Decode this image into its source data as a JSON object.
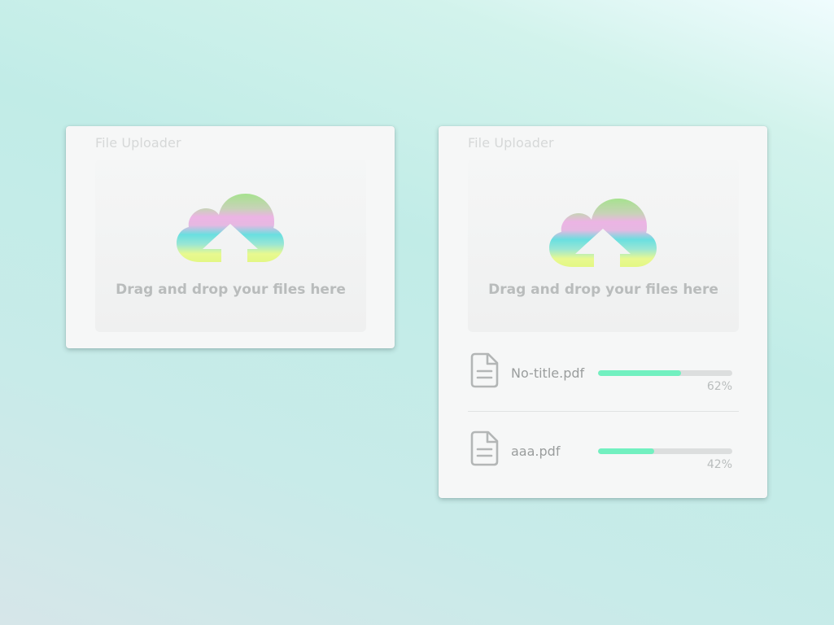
{
  "colors": {
    "card_background": "#f6f7f7",
    "dropzone_background": "#f1f2f2",
    "progress_fill": "#72f0c0",
    "progress_track": "#dcdede",
    "cloud_gradient": [
      "#a6e28e",
      "#ecb4e4",
      "#69dfe0",
      "#e8f990"
    ]
  },
  "uploaders": [
    {
      "title": "File Uploader",
      "dropzone": {
        "icon": "cloud-upload-icon",
        "text": "Drag and drop your files here"
      },
      "files": []
    },
    {
      "title": "File Uploader",
      "dropzone": {
        "icon": "cloud-upload-icon",
        "text": "Drag and drop your files here"
      },
      "files": [
        {
          "icon": "file-document-icon",
          "name": "No-title.pdf",
          "progress": 62,
          "progress_label": "62%"
        },
        {
          "icon": "file-document-icon",
          "name": "aaa.pdf",
          "progress": 42,
          "progress_label": "42%"
        }
      ]
    }
  ]
}
